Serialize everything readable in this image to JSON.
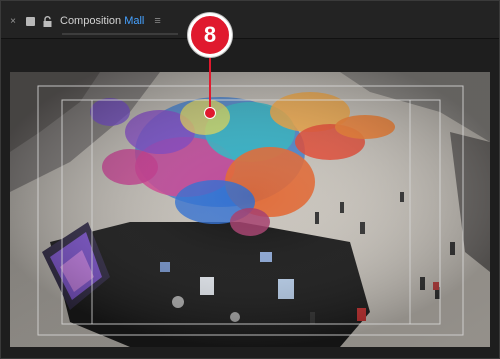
{
  "window": {
    "tab": {
      "close_glyph": "×",
      "prefix": "Composition",
      "comp_name": "Mall",
      "menu_glyph": "≡",
      "accent_color": "#45a1ff"
    }
  },
  "callout": {
    "number": "8",
    "color": "#e0192e"
  },
  "icons": [
    "close-icon",
    "color-label-swatch-icon",
    "lock-icon",
    "panel-menu-icon"
  ]
}
